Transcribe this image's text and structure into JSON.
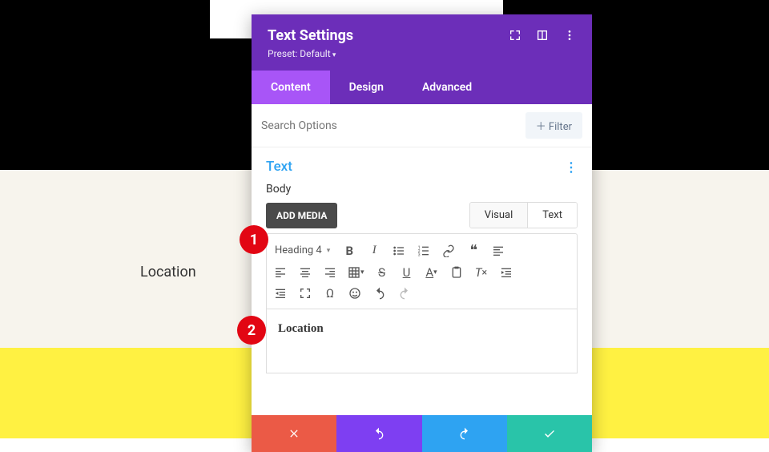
{
  "bg": {
    "location_label": "Location"
  },
  "modal": {
    "title": "Text Settings",
    "preset": "Preset: Default",
    "tabs": {
      "content": "Content",
      "design": "Design",
      "advanced": "Advanced"
    },
    "search_placeholder": "Search Options",
    "filter_label": "＋ Filter",
    "section_title": "Text",
    "body_label": "Body",
    "add_media": "ADD MEDIA",
    "mode": {
      "visual": "Visual",
      "text": "Text"
    },
    "format_select": "Heading 4",
    "editor_content": "Location"
  },
  "callouts": {
    "one": "1",
    "two": "2"
  }
}
